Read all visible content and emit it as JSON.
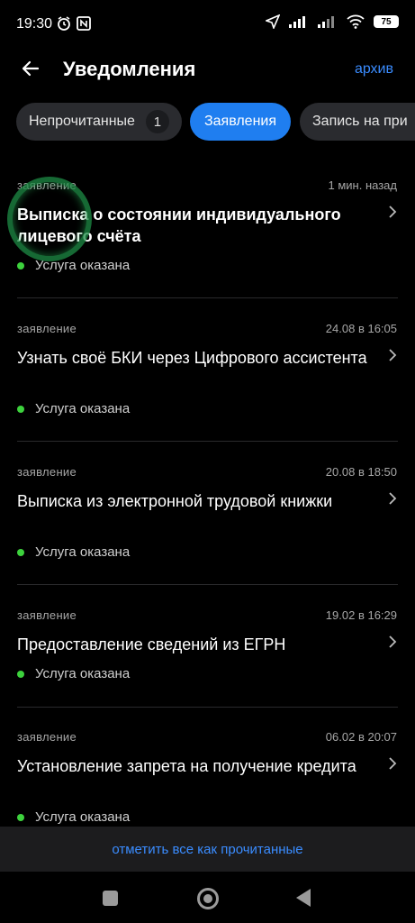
{
  "status_bar": {
    "time": "19:30",
    "battery": "75"
  },
  "header": {
    "title": "Уведомления",
    "archive_label": "архив"
  },
  "tabs": [
    {
      "label": "Непрочитанные",
      "count": "1"
    },
    {
      "label": "Заявления"
    },
    {
      "label": "Запись на при"
    }
  ],
  "notifications": [
    {
      "kind": "заявление",
      "date": "1 мин. назад",
      "title": "Выписка о состоянии индивидуального лицевого счёта",
      "status": "Услуга оказана"
    },
    {
      "kind": "заявление",
      "date": "24.08 в 16:05",
      "title": "Узнать своё БКИ через Цифрового ассистента",
      "status": "Услуга оказана"
    },
    {
      "kind": "заявление",
      "date": "20.08 в 18:50",
      "title": "Выписка из электронной трудовой книжки",
      "status": "Услуга оказана"
    },
    {
      "kind": "заявление",
      "date": "19.02 в 16:29",
      "title": "Предоставление сведений из ЕГРН",
      "status": "Услуга оказана"
    },
    {
      "kind": "заявление",
      "date": "06.02 в 20:07",
      "title": "Установление запрета на получение кредита",
      "status": "Услуга оказана"
    }
  ],
  "footer": {
    "mark_all_label": "отметить все как прочитанные"
  },
  "colors": {
    "accent": "#1f7ef0",
    "link": "#3a8cff",
    "status_ok": "#3dd23d"
  }
}
